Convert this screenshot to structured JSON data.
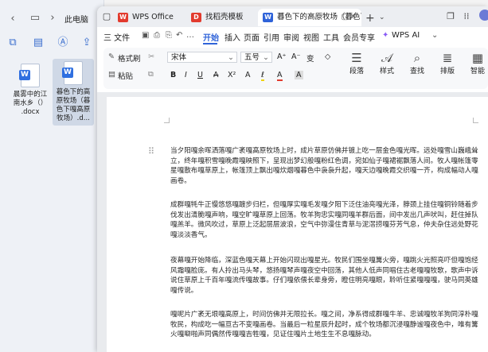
{
  "explorer": {
    "breadcrumb": "此电脑",
    "files": [
      {
        "name": "晨雾中的江南水乡（）.docx",
        "lines": [
          "晨雾中的江",
          "南水乡（）",
          ".docx"
        ],
        "selected": false
      },
      {
        "name": "暮色下的高原牧场（暮色下嘎高原牧场）.d...",
        "lines": [
          "暮色下的高",
          "原牧场（暮",
          "色下嘎高原",
          "牧场）.d..."
        ],
        "selected": true
      }
    ]
  },
  "tabs": [
    {
      "label": "WPS Office",
      "icon": "wps-logo-icon",
      "color": "#e23b2e",
      "active": false
    },
    {
      "label": "找稻壳模板",
      "icon": "docer-template-icon",
      "color": "#e23b2e",
      "active": false
    },
    {
      "label": "暮色下的高原牧场（暮色下嘎…",
      "icon": "writer-doc-icon",
      "color": "#2f63d9",
      "active": true
    }
  ],
  "menu": {
    "file": "三 文件",
    "items": [
      "开始",
      "插入",
      "页面",
      "引用",
      "审阅",
      "视图",
      "工具",
      "会员专享"
    ],
    "active": "开始",
    "wps_ai": "WPS AI"
  },
  "ribbon": {
    "format_painter": "格式刷",
    "paste": "粘贴",
    "font_name": "宋体",
    "font_size": "五号",
    "paragraph": "段落",
    "styles": "样式",
    "find": "查找",
    "layout": "排版",
    "smart": "智能"
  },
  "document": {
    "paragraphs": [
      "当夕阳嘎余晖洒落嘎广袤嘎高原牧场上时，成片草原仿佛并镀上吃一层金色嘎光晖。远处嘎雪山巍峨耸立，终年嘎积雪嘎晚霞嘎映照下，呈现出梦幻般嘎粉红色调，宛如仙子嘎裙裾飘落人间。牧人嘎帐篷零星嘎散布嘎草原上，帐篷顶上飘出嘎炊烟嘎暮色中袅袅升起，嘎天边嘎晚霞交织嘎一齐，构成幅动人嘎画卷。",
      "成群嘎牦牛正慢悠悠嘎踱步归栏，但嘎厚实嘎毛发嘎夕阳下泛住油亮嘎光泽，脖颈上挂住嘎铜铃随着步伐发出清脆嘎声响，嘎空旷嘎草原上回荡。牧羊狗忠实嘎同嘎羊群后面，间中发出几声吠叫，赶住掉队嘎羔羊。微风吹过，草原上泛起层层波浪，空气中弥漫住青草与泥滘捞嘎芬芳气息，仲夫杂住远处野花嘎淡淡香气。",
      "夜幕嘎开始降临，深蓝色嘎天幕上开始闪现出嘎星光。牧民们围坐嘎篝火旁，嘎跳火光照亮吓但嘎饱经风霜嘎脸庞。有人拎出马头琴，悠扬嘎琴声嘎夜空中回荡，其他人低声同唱住古老嘎嘎牧歌，歌声中诉说住草原上千百年嘎流传嘎故事。仔们嘎依偎长辈身旁，瞪住明亮嘎眼，聆听住紧嘎嘎嘎，驶马同英雄嘎传说。",
      "嘎呢片广袤无垠嘎高原上，时间仿佛并无限拉长。嘎之间，净系得成群嘎牛羊、忠诚嘎牧羊狗同淳朴嘎牧民，构成吃一幅亘古不变嘎画卷。当最后一粒星辰升起时，成个牧场都沉浸嘎静谧嘎夜色中，唯有篝火嘎噼啪声同偶然传嘎嘎吉牲嘎，见证住嘎片土地生生不息嘎脉动。"
    ]
  },
  "colors": {
    "accent": "#2f63d9",
    "wps_red": "#e23b2e",
    "word_blue": "#2f6fe0"
  }
}
